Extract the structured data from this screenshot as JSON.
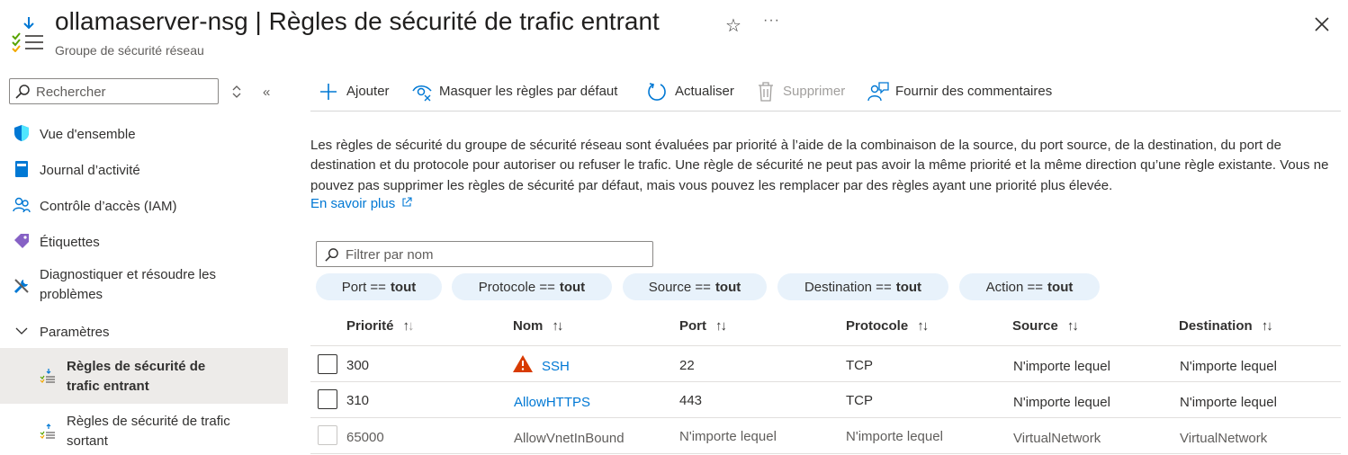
{
  "header": {
    "resource_name": "ollamaserver-nsg",
    "separator": " | ",
    "page_title": "Règles de sécurité de trafic entrant",
    "subtitle": "Groupe de sécurité réseau",
    "star_glyph": "☆",
    "more_glyph": "···"
  },
  "sidebar": {
    "search_placeholder": "Rechercher",
    "collapse_glyph": "«",
    "items": [
      {
        "label": "Vue d'ensemble",
        "icon": "shield-icon"
      },
      {
        "label": "Journal d’activité",
        "icon": "journal-icon"
      },
      {
        "label": "Contrôle d’accès (IAM)",
        "icon": "people-icon"
      },
      {
        "label": "Étiquettes",
        "icon": "tag-icon"
      },
      {
        "label_line1": "Diagnostiquer et résoudre les",
        "label_line2": "problèmes",
        "icon": "wrench-icon"
      }
    ],
    "section": {
      "label": "Paramètres",
      "icon": "chevron-down-icon"
    },
    "sub_items": [
      {
        "label_line1": "Règles de sécurité de",
        "label_line2": "trafic entrant",
        "selected": true
      },
      {
        "label_line1": "Règles de sécurité de trafic",
        "label_line2": "sortant",
        "selected": false
      }
    ]
  },
  "toolbar": {
    "add": "Ajouter",
    "hide_defaults": "Masquer les règles par défaut",
    "refresh": "Actualiser",
    "delete": "Supprimer",
    "feedback": "Fournir des commentaires"
  },
  "description": {
    "text": "Les règles de sécurité du groupe de sécurité réseau sont évaluées par priorité à l’aide de la combinaison de la source, du port source, de la destination, du port de destination et du protocole pour autoriser ou refuser le trafic. Une règle de sécurité ne peut pas avoir la même priorité et la même direction qu’une règle existante. Vous ne pouvez pas supprimer les règles de sécurité par défaut, mais vous pouvez les remplacer par des règles ayant une priorité plus élevée.",
    "learn_more": "En savoir plus"
  },
  "filter": {
    "placeholder": "Filtrer par nom",
    "pills": [
      {
        "field": "Port ==",
        "value": "tout"
      },
      {
        "field": "Protocole ==",
        "value": "tout"
      },
      {
        "field": "Source ==",
        "value": "tout"
      },
      {
        "field": "Destination ==",
        "value": "tout"
      },
      {
        "field": "Action ==",
        "value": "tout"
      }
    ]
  },
  "table": {
    "sort_glyph_up": "↑",
    "sort_glyph_down": "↓",
    "columns": [
      "Priorité",
      "Nom",
      "Port",
      "Protocole",
      "Source",
      "Destination"
    ],
    "rows": [
      {
        "priority": "300",
        "name": "SSH",
        "port": "22",
        "protocol": "TCP",
        "source": "N'importe lequel",
        "destination": "N'importe lequel",
        "warning": true
      },
      {
        "priority": "310",
        "name": "AllowHTTPS",
        "port": "443",
        "protocol": "TCP",
        "source": "N'importe lequel",
        "destination": "N'importe lequel",
        "warning": false
      },
      {
        "priority": "65000",
        "name": "AllowVnetInBound",
        "port": "N'importe lequel",
        "protocol": "N'importe lequel",
        "source": "VirtualNetwork",
        "destination": "VirtualNetwork",
        "warning": false
      }
    ]
  },
  "colors": {
    "link": "#0078d4",
    "pill_bg": "#e8f2fb",
    "selected_bg": "#edebe9",
    "warning": "#d83b01"
  }
}
